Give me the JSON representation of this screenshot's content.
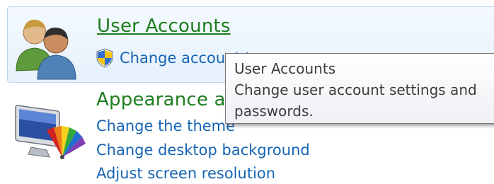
{
  "categories": [
    {
      "title": "User Accounts",
      "links": [
        "Change account type"
      ],
      "icon": "users-icon",
      "link_icon": "uac-shield-icon"
    },
    {
      "title": "Appearance and Personalization",
      "links": [
        "Change the theme",
        "Change desktop background",
        "Adjust screen resolution"
      ],
      "icon": "monitor-palette-icon"
    }
  ],
  "tooltip": {
    "title": "User Accounts",
    "lines": [
      "Change user account settings and",
      "passwords."
    ]
  },
  "colors": {
    "heading": "#1e7d1e",
    "link": "#1664b5",
    "hover_bg": "#e6f1fb",
    "hover_border": "#bcd9f4"
  }
}
